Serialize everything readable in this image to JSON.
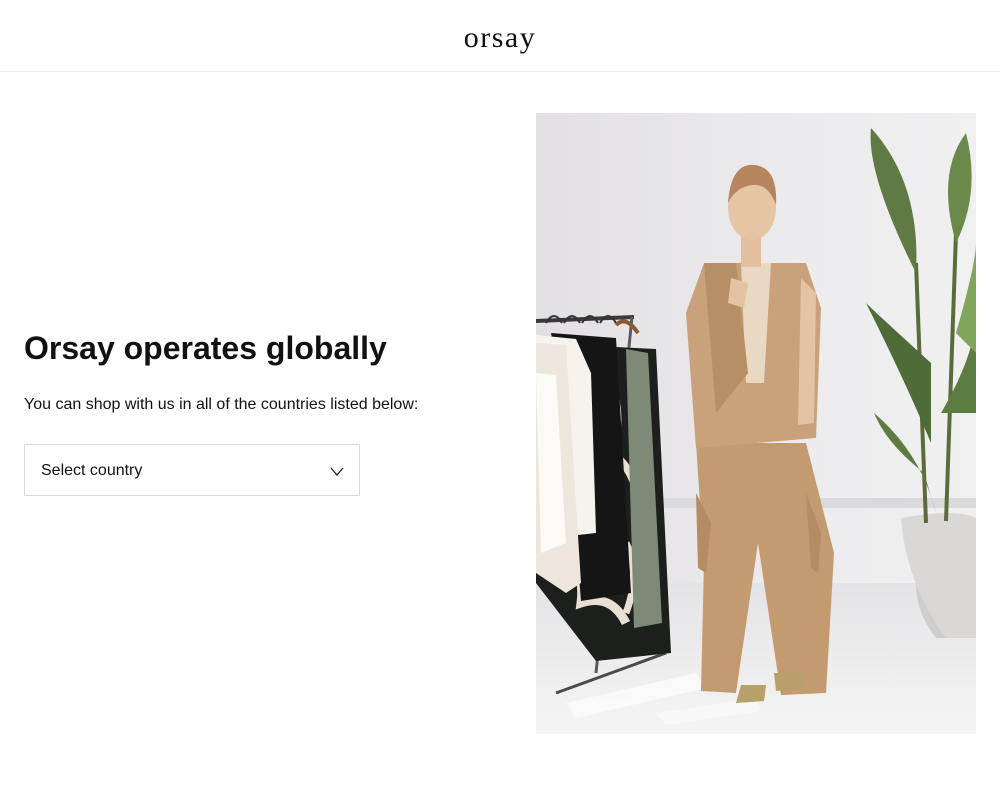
{
  "header": {
    "logo_text": "orsay"
  },
  "main": {
    "title": "Orsay operates globally",
    "subtitle": "You can shop with us in all of the countries listed below:",
    "country_select": {
      "value": "Select country",
      "icon": "chevron-down-icon"
    }
  },
  "hero": {
    "icon": "fashion-photo"
  },
  "colors": {
    "text": "#111111",
    "border": "#d8d8d8",
    "divider": "#ececec",
    "outfit": "#c9a17a"
  }
}
